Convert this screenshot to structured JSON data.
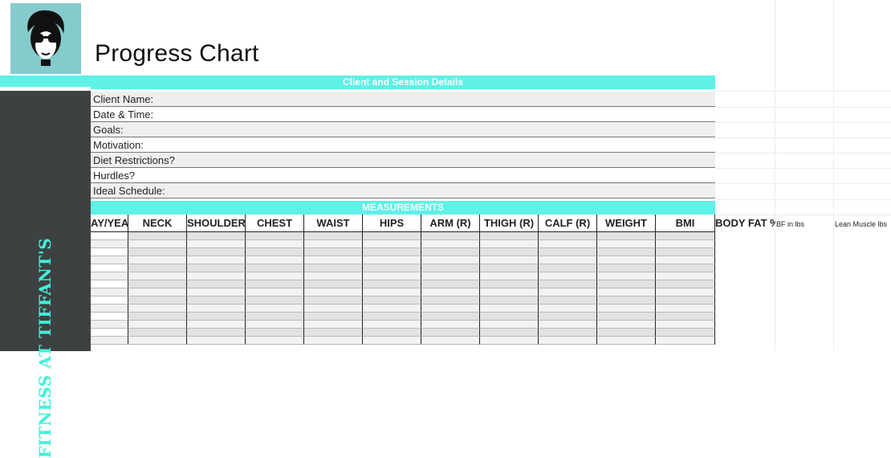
{
  "title": "Progress Chart",
  "brand_vertical": "FITNESS AT TIFFANT'S",
  "sections": {
    "client_details": "Client and Session Details",
    "measurements": "MEASUREMENTS"
  },
  "client_fields": [
    "Client Name:",
    "Date & Time:",
    "Goals:",
    "Motivation:",
    "Diet Restrictions?",
    "Hurdles?",
    "Ideal Schedule:"
  ],
  "measure_headers": [
    "AY/YEA",
    "NECK",
    "SHOULDER",
    "CHEST",
    "WAIST",
    "HIPS",
    "ARM (R)",
    "THIGH (R)",
    "CALF (R)",
    "WEIGHT",
    "BMI",
    "BODY FAT %",
    "BF in lbs",
    "Lean Muscle lbs"
  ],
  "colors": {
    "accent_teal": "#5ff0e6",
    "logo_bg": "#86cbcc",
    "sidebar_bg": "#3d4141",
    "brand_text": "#43f0d9",
    "row_alt": "#efefef"
  },
  "icons": {
    "logo": "woman-with-sunglasses-icon"
  }
}
